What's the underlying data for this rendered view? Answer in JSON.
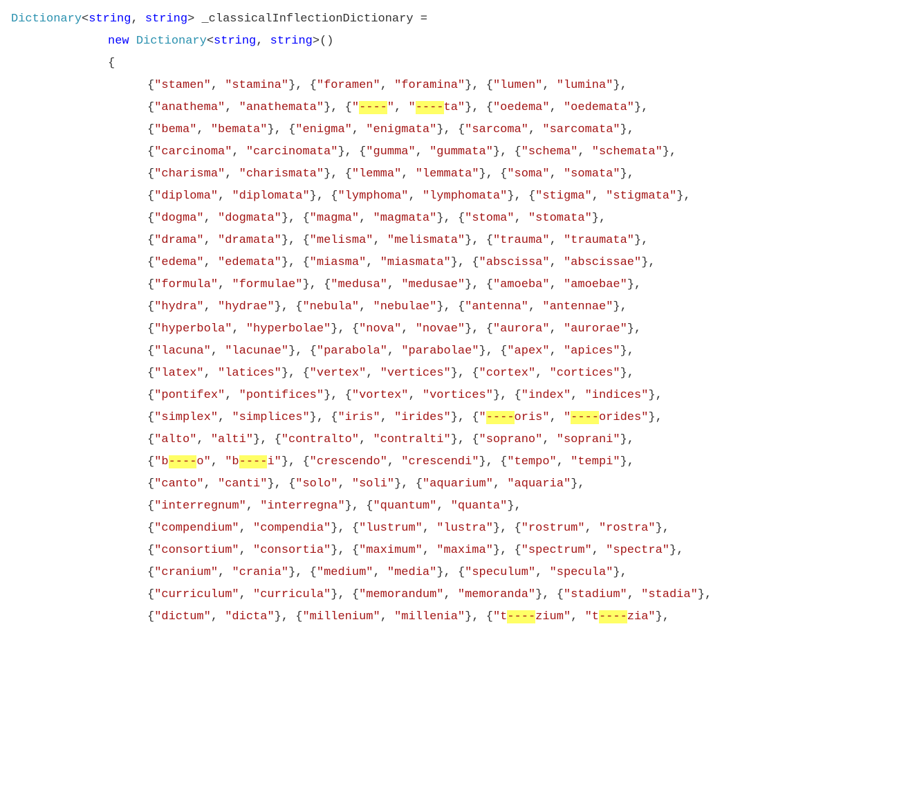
{
  "decl": {
    "type": "Dictionary",
    "param1": "string",
    "param2": "string",
    "varName": "_classicalInflectionDictionary",
    "newKw": "new"
  },
  "highlight": "----",
  "lines": [
    [
      {
        "k": "stamen",
        "v": "stamina"
      },
      {
        "k": "foramen",
        "v": "foramina"
      },
      {
        "k": "lumen",
        "v": "lumina"
      }
    ],
    [
      {
        "k": "anathema",
        "v": "anathemata"
      },
      {
        "kParts": [
          "\"",
          "HL",
          "\""
        ],
        "vParts": [
          "\"",
          "HL",
          "ta\""
        ]
      },
      {
        "k": "oedema",
        "v": "oedemata"
      }
    ],
    [
      {
        "k": "bema",
        "v": "bemata"
      },
      {
        "k": "enigma",
        "v": "enigmata"
      },
      {
        "k": "sarcoma",
        "v": "sarcomata"
      }
    ],
    [
      {
        "k": "carcinoma",
        "v": "carcinomata"
      },
      {
        "k": "gumma",
        "v": "gummata"
      },
      {
        "k": "schema",
        "v": "schemata"
      }
    ],
    [
      {
        "k": "charisma",
        "v": "charismata"
      },
      {
        "k": "lemma",
        "v": "lemmata"
      },
      {
        "k": "soma",
        "v": "somata"
      }
    ],
    [
      {
        "k": "diploma",
        "v": "diplomata"
      },
      {
        "k": "lymphoma",
        "v": "lymphomata"
      },
      {
        "k": "stigma",
        "v": "stigmata"
      }
    ],
    [
      {
        "k": "dogma",
        "v": "dogmata"
      },
      {
        "k": "magma",
        "v": "magmata"
      },
      {
        "k": "stoma",
        "v": "stomata"
      }
    ],
    [
      {
        "k": "drama",
        "v": "dramata"
      },
      {
        "k": "melisma",
        "v": "melismata"
      },
      {
        "k": "trauma",
        "v": "traumata"
      }
    ],
    [
      {
        "k": "edema",
        "v": "edemata"
      },
      {
        "k": "miasma",
        "v": "miasmata"
      },
      {
        "k": "abscissa",
        "v": "abscissae"
      }
    ],
    [
      {
        "k": "formula",
        "v": "formulae"
      },
      {
        "k": "medusa",
        "v": "medusae"
      },
      {
        "k": "amoeba",
        "v": "amoebae"
      }
    ],
    [
      {
        "k": "hydra",
        "v": "hydrae"
      },
      {
        "k": "nebula",
        "v": "nebulae"
      },
      {
        "k": "antenna",
        "v": "antennae"
      }
    ],
    [
      {
        "k": "hyperbola",
        "v": "hyperbolae"
      },
      {
        "k": "nova",
        "v": "novae"
      },
      {
        "k": "aurora",
        "v": "aurorae"
      }
    ],
    [
      {
        "k": "lacuna",
        "v": "lacunae"
      },
      {
        "k": "parabola",
        "v": "parabolae"
      },
      {
        "k": "apex",
        "v": "apices"
      }
    ],
    [
      {
        "k": "latex",
        "v": "latices"
      },
      {
        "k": "vertex",
        "v": "vertices"
      },
      {
        "k": "cortex",
        "v": "cortices"
      }
    ],
    [
      {
        "k": "pontifex",
        "v": "pontifices"
      },
      {
        "k": "vortex",
        "v": "vortices"
      },
      {
        "k": "index",
        "v": "indices"
      }
    ],
    [
      {
        "k": "simplex",
        "v": "simplices"
      },
      {
        "k": "iris",
        "v": "irides"
      },
      {
        "kParts": [
          "\"",
          "HL",
          "oris\""
        ],
        "vParts": [
          "\"",
          "HL",
          "orides\""
        ]
      }
    ],
    [
      {
        "k": "alto",
        "v": "alti"
      },
      {
        "k": "contralto",
        "v": "contralti"
      },
      {
        "k": "soprano",
        "v": "soprani"
      }
    ],
    [
      {
        "kParts": [
          "\"b",
          "HL",
          "o\""
        ],
        "vParts": [
          "\"b",
          "HL",
          "i\""
        ]
      },
      {
        "k": "crescendo",
        "v": "crescendi"
      },
      {
        "k": "tempo",
        "v": "tempi"
      }
    ],
    [
      {
        "k": "canto",
        "v": "canti"
      },
      {
        "k": "solo",
        "v": "soli"
      },
      {
        "k": "aquarium",
        "v": "aquaria"
      }
    ],
    [
      {
        "k": "interregnum",
        "v": "interregna"
      },
      {
        "k": "quantum",
        "v": "quanta"
      }
    ],
    [
      {
        "k": "compendium",
        "v": "compendia"
      },
      {
        "k": "lustrum",
        "v": "lustra"
      },
      {
        "k": "rostrum",
        "v": "rostra"
      }
    ],
    [
      {
        "k": "consortium",
        "v": "consortia"
      },
      {
        "k": "maximum",
        "v": "maxima"
      },
      {
        "k": "spectrum",
        "v": "spectra"
      }
    ],
    [
      {
        "k": "cranium",
        "v": "crania"
      },
      {
        "k": "medium",
        "v": "media"
      },
      {
        "k": "speculum",
        "v": "specula"
      }
    ],
    [
      {
        "k": "curriculum",
        "v": "curricula"
      },
      {
        "k": "memorandum",
        "v": "memoranda"
      },
      {
        "k": "stadium",
        "v": "stadia"
      }
    ],
    [
      {
        "k": "dictum",
        "v": "dicta"
      },
      {
        "k": "millenium",
        "v": "millenia"
      },
      {
        "kParts": [
          "\"t",
          "HL",
          "zium\""
        ],
        "vParts": [
          "\"t",
          "HL",
          "zia\""
        ]
      }
    ]
  ]
}
